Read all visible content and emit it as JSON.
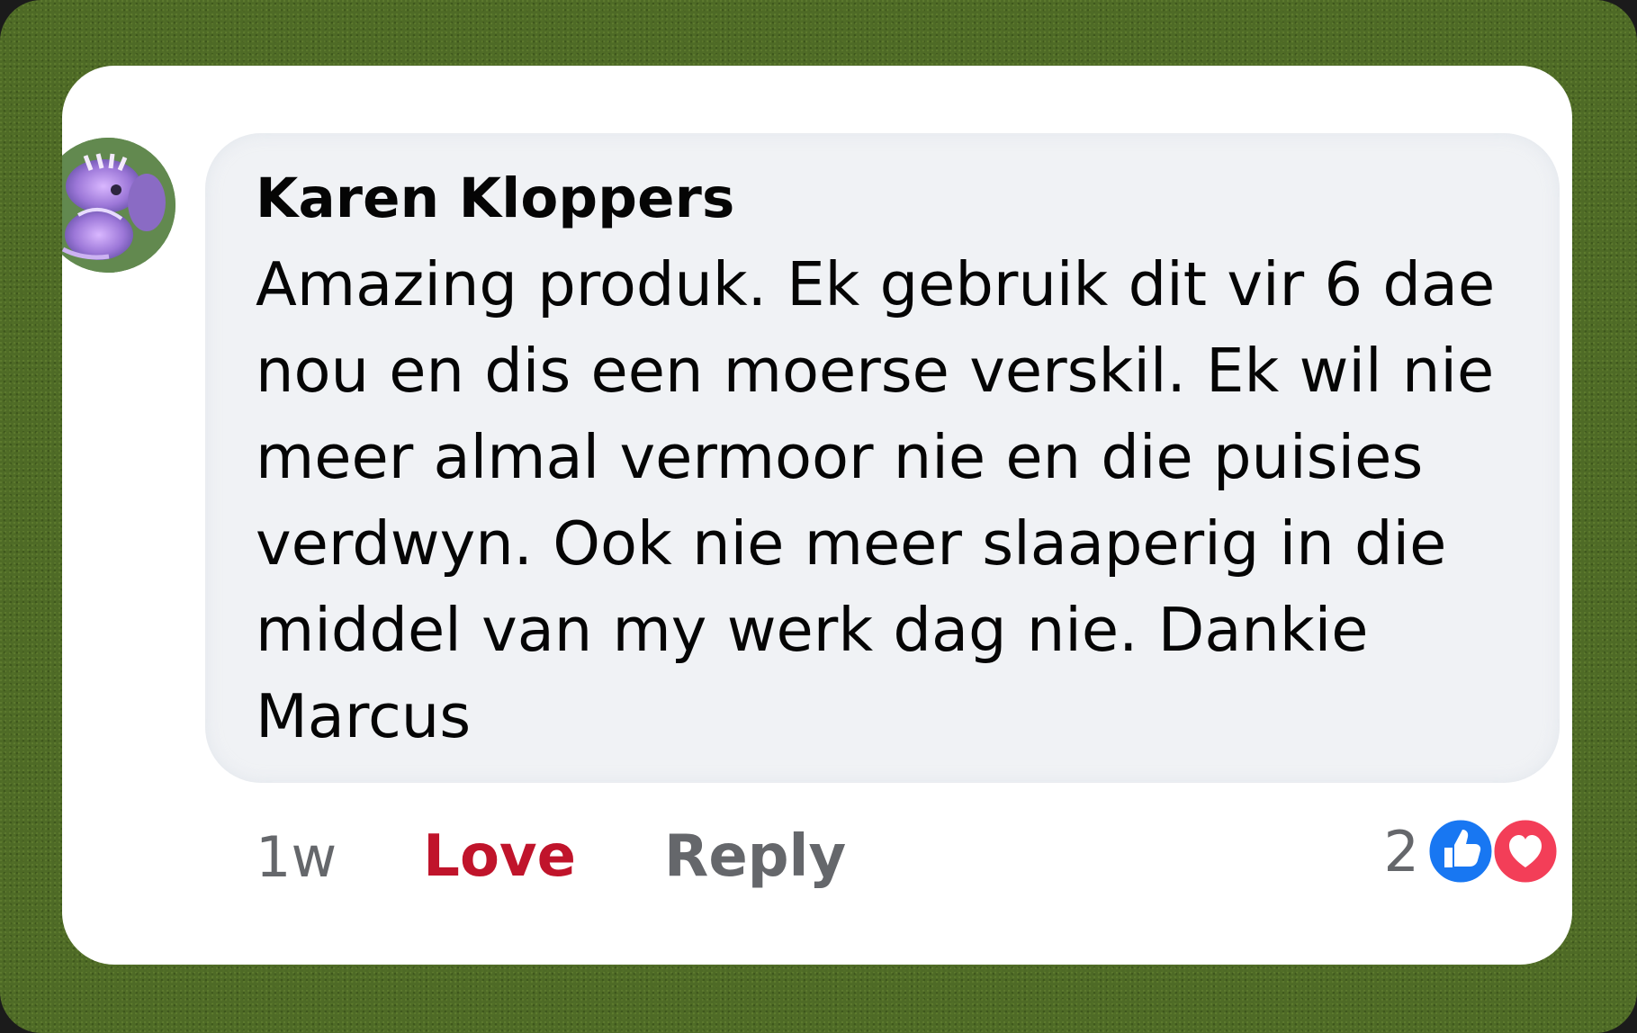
{
  "comment": {
    "author": "Karen Kloppers",
    "text_lines": [
      "Amazing produk. Ek gebruik dit vir 6 dae",
      "nou en dis een moerse verskil. Ek wil nie",
      "meer almal vermoor nie en die puisies",
      "verdwyn. Ook nie meer slaaperig in die",
      "middel van my werk dag nie. Dankie",
      "Marcus"
    ],
    "time": "1w",
    "love_label": "Love",
    "reply_label": "Reply",
    "reaction_count": "2",
    "reaction_icons": [
      "like-icon",
      "love-icon"
    ]
  },
  "colors": {
    "background_border": "#4e6a26",
    "bubble": "#f0f2f5",
    "love": "#c0142b",
    "muted": "#65676b",
    "like_blue": "#1877f2",
    "love_red": "#f33e58"
  }
}
